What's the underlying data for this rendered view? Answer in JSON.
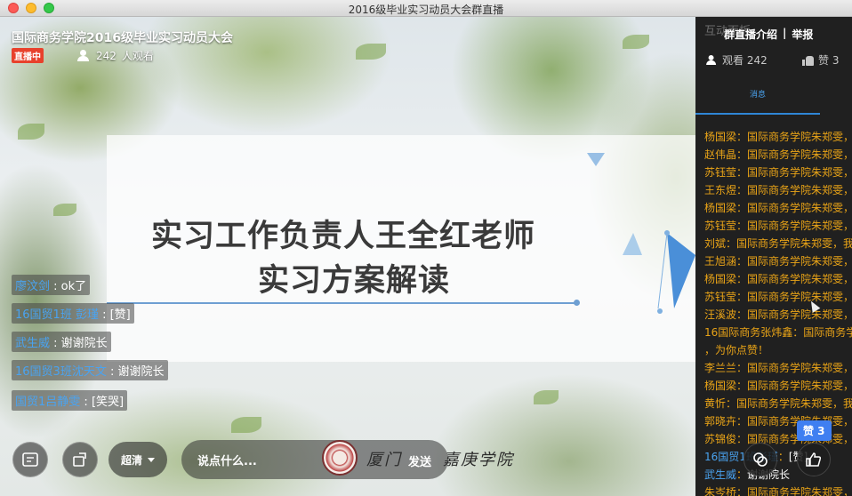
{
  "window": {
    "title": "2016级毕业实习动员大会群直播"
  },
  "live": {
    "title": "国际商务学院2016级毕业实习动员大会",
    "badge": "直播中",
    "viewers": "242",
    "viewers_suffix": "人观看"
  },
  "slide": {
    "line1": "实习工作负责人王全红老师",
    "line2": "实习方案解读"
  },
  "danmaku": [
    {
      "name": "廖汶剑",
      "text": "ok了"
    },
    {
      "name": "16国贸1班 彭瑾",
      "text": "[赞]"
    },
    {
      "name": "武生威",
      "text": "谢谢院长"
    },
    {
      "name": "16国贸3班沈天文",
      "text": "谢谢院长"
    },
    {
      "name": "国贸1吕静雯",
      "text": "[笑哭]"
    }
  ],
  "controls": {
    "quality_label": "超清",
    "input_placeholder": "说点什么...",
    "send_label": "发送",
    "calligraphy_a": "厦门",
    "calligraphy_b": "嘉庚学院"
  },
  "panel": {
    "ghost_tab": "互动面板",
    "intro_tab": "群直播介绍",
    "separator": "|",
    "report_tab": "举报",
    "viewers_label": "观看 242",
    "likes_label": "赞 3",
    "messages_tab": "消息",
    "like_badge": "赞 3"
  },
  "messages": [
    {
      "user": "杨国梁",
      "text": "国际商务学院朱郑雯，",
      "color": "gold"
    },
    {
      "user": "赵伟晶",
      "text": "国际商务学院朱郑雯，",
      "color": "gold"
    },
    {
      "user": "苏钰莹",
      "text": "国际商务学院朱郑雯，",
      "color": "gold"
    },
    {
      "user": "王东煜",
      "text": "国际商务学院朱郑雯，",
      "color": "gold"
    },
    {
      "user": "杨国梁",
      "text": "国际商务学院朱郑雯，",
      "color": "gold"
    },
    {
      "user": "苏钰莹",
      "text": "国际商务学院朱郑雯，",
      "color": "gold"
    },
    {
      "user": "刘斌",
      "text": "国际商务学院朱郑雯，我",
      "color": "gold"
    },
    {
      "user": "王旭涵",
      "text": "国际商务学院朱郑雯，",
      "color": "gold"
    },
    {
      "user": "杨国梁",
      "text": "国际商务学院朱郑雯，",
      "color": "gold"
    },
    {
      "user": "苏钰莹",
      "text": "国际商务学院朱郑雯，",
      "color": "gold"
    },
    {
      "user": "汪溪波",
      "text": "国际商务学院朱郑雯，",
      "color": "gold"
    },
    {
      "user": "16国际商务张炜鑫",
      "text": "国际商务学",
      "color": "gold"
    },
    {
      "user": "",
      "text": "，为你点赞！",
      "color": "gold"
    },
    {
      "user": "李兰兰",
      "text": "国际商务学院朱郑雯，",
      "color": "gold"
    },
    {
      "user": "杨国梁",
      "text": "国际商务学院朱郑雯，",
      "color": "gold"
    },
    {
      "user": "黄忻",
      "text": "国际商务学院朱郑雯，我",
      "color": "gold"
    },
    {
      "user": "郭晓卉",
      "text": "国际商务学院朱郑雯，",
      "color": "gold"
    },
    {
      "user": "苏锦俊",
      "text": "国际商务学院朱郑雯，",
      "color": "gold"
    },
    {
      "user": "16国贸1班彭瑾",
      "text": "[赞]",
      "color": "blue"
    },
    {
      "user": "武生威",
      "text": "谢谢院长",
      "color": "blue"
    },
    {
      "user": "朱岑桥",
      "text": "国际商务学院朱郑雯，",
      "color": "gold"
    }
  ]
}
